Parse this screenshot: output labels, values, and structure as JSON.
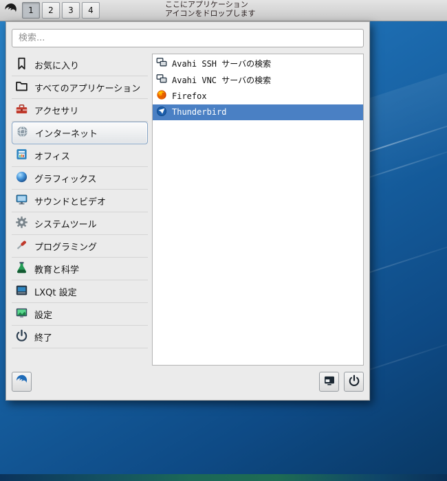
{
  "panel": {
    "workspaces": [
      "1",
      "2",
      "3",
      "4"
    ],
    "active_workspace": "1",
    "drop_hint_line1": "ここにアプリケーション",
    "drop_hint_line2": "アイコンをドロップします"
  },
  "menu": {
    "search_placeholder": "検索...",
    "categories": [
      {
        "label": "お気に入り",
        "icon": "bookmark-icon",
        "selected": false
      },
      {
        "label": "すべてのアプリケーション",
        "icon": "folder-icon",
        "selected": false
      },
      {
        "label": "アクセサリ",
        "icon": "toolbox-icon",
        "selected": false
      },
      {
        "label": "インターネット",
        "icon": "globe-icon",
        "selected": true
      },
      {
        "label": "オフィス",
        "icon": "office-icon",
        "selected": false
      },
      {
        "label": "グラフィックス",
        "icon": "sphere-icon",
        "selected": false
      },
      {
        "label": "サウンドとビデオ",
        "icon": "monitor-icon",
        "selected": false
      },
      {
        "label": "システムツール",
        "icon": "gear-icon",
        "selected": false
      },
      {
        "label": "プログラミング",
        "icon": "tools-icon",
        "selected": false
      },
      {
        "label": "教育と科学",
        "icon": "flask-icon",
        "selected": false
      },
      {
        "label": "LXQt 設定",
        "icon": "lxqt-settings-icon",
        "selected": false
      },
      {
        "label": "設定",
        "icon": "settings-icon",
        "selected": false
      },
      {
        "label": "終了",
        "icon": "power-icon",
        "selected": false
      }
    ],
    "apps": [
      {
        "label": "Avahi SSH サーバの検索",
        "icon": "avahi-icon",
        "selected": false
      },
      {
        "label": "Avahi VNC サーバの検索",
        "icon": "avahi-icon",
        "selected": false
      },
      {
        "label": "Firefox",
        "icon": "firefox-icon",
        "selected": false
      },
      {
        "label": "Thunderbird",
        "icon": "thunderbird-icon",
        "selected": true
      }
    ]
  },
  "colors": {
    "selection_blue": "#4a80c4",
    "menu_bg": "#ebebeb",
    "panel_bg": "#d5d5d5",
    "desktop_top": "#2a82c6",
    "desktop_bottom": "#093864"
  }
}
